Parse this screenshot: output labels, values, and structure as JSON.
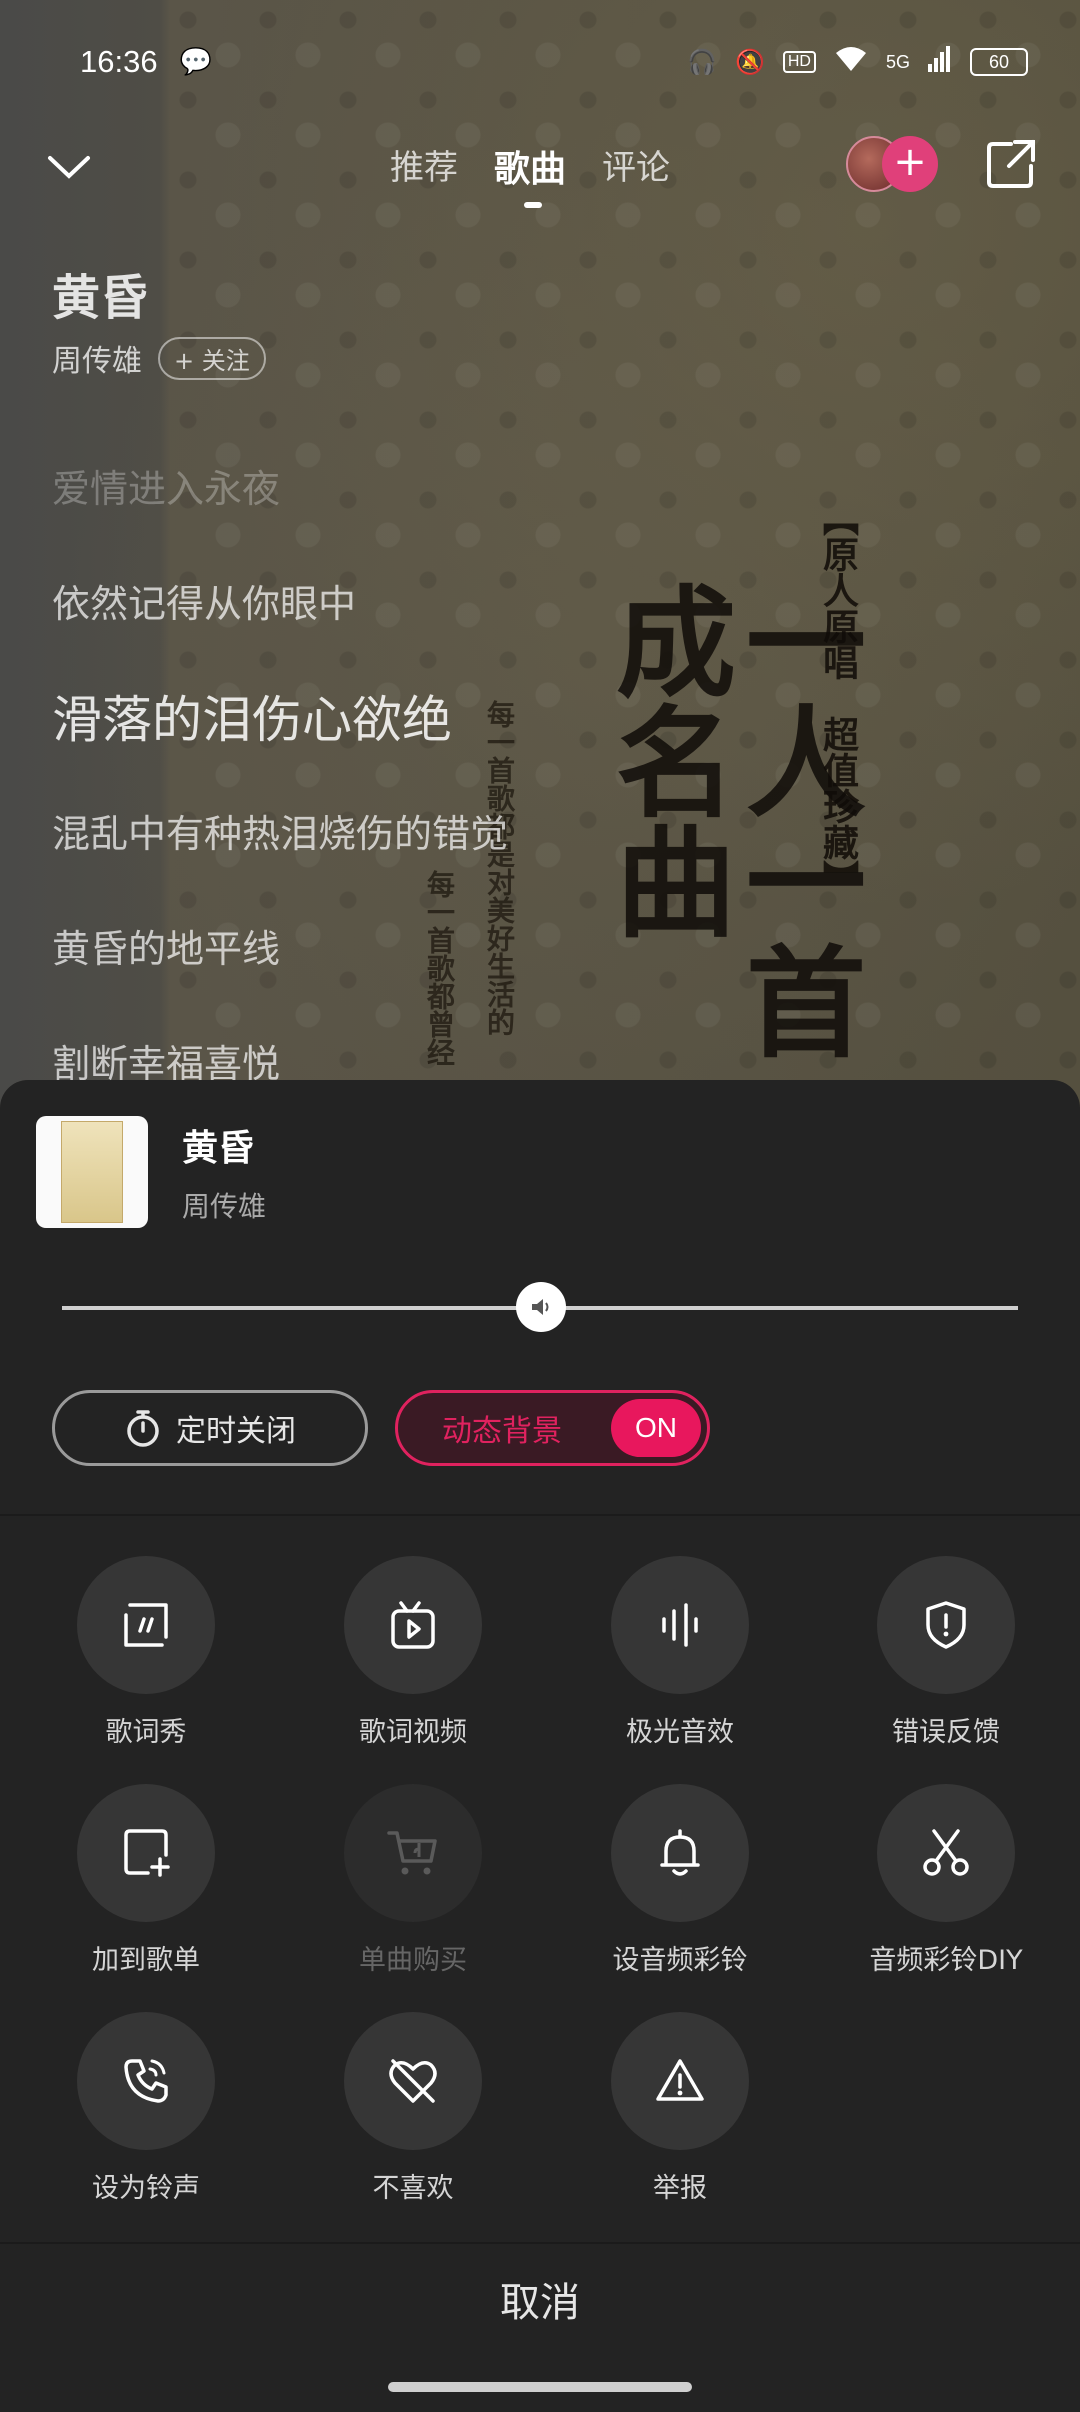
{
  "status_bar": {
    "time": "16:36",
    "battery": "60",
    "network": "5G"
  },
  "nav": {
    "tabs": [
      "推荐",
      "歌曲",
      "评论"
    ],
    "active_tab": "歌曲"
  },
  "song": {
    "title": "黄昏",
    "artist": "周传雄",
    "follow_label": "+ 关注"
  },
  "lyrics": [
    {
      "text": "爱情进入永夜",
      "state": "past"
    },
    {
      "text": "依然记得从你眼中",
      "state": "normal"
    },
    {
      "text": "滑落的泪伤心欲绝",
      "state": "current"
    },
    {
      "text": "混乱中有种热泪烧伤的错觉",
      "state": "normal"
    },
    {
      "text": "黄昏的地平线",
      "state": "normal"
    },
    {
      "text": "割断幸福喜悦",
      "state": "normal"
    }
  ],
  "album_art_text": {
    "line1": "【原人原唱　超值珍藏】",
    "big": "一人一首成名曲",
    "side1": "每一首歌都曾经",
    "side2": "每一首歌都是对美好生活的"
  },
  "panel": {
    "now_title": "黄昏",
    "now_artist": "周传雄",
    "volume_level": 0.5,
    "timer_label": "定时关闭",
    "dynamic_bg_label": "动态背景",
    "dynamic_bg_state": "ON",
    "cancel_label": "取消"
  },
  "actions": [
    {
      "label": "歌词秀",
      "icon": "lyrics-show-icon",
      "enabled": true
    },
    {
      "label": "歌词视频",
      "icon": "lyrics-video-icon",
      "enabled": true
    },
    {
      "label": "极光音效",
      "icon": "sound-effect-icon",
      "enabled": true
    },
    {
      "label": "错误反馈",
      "icon": "feedback-shield-icon",
      "enabled": true
    },
    {
      "label": "加到歌单",
      "icon": "add-to-playlist-icon",
      "enabled": true
    },
    {
      "label": "单曲购买",
      "icon": "cart-icon",
      "enabled": false
    },
    {
      "label": "设音频彩铃",
      "icon": "bell-icon",
      "enabled": true
    },
    {
      "label": "音频彩铃DIY",
      "icon": "scissors-icon",
      "enabled": true
    },
    {
      "label": "设为铃声",
      "icon": "phone-ring-icon",
      "enabled": true
    },
    {
      "label": "不喜欢",
      "icon": "heart-broken-icon",
      "enabled": true
    },
    {
      "label": "举报",
      "icon": "warning-icon",
      "enabled": true
    }
  ]
}
